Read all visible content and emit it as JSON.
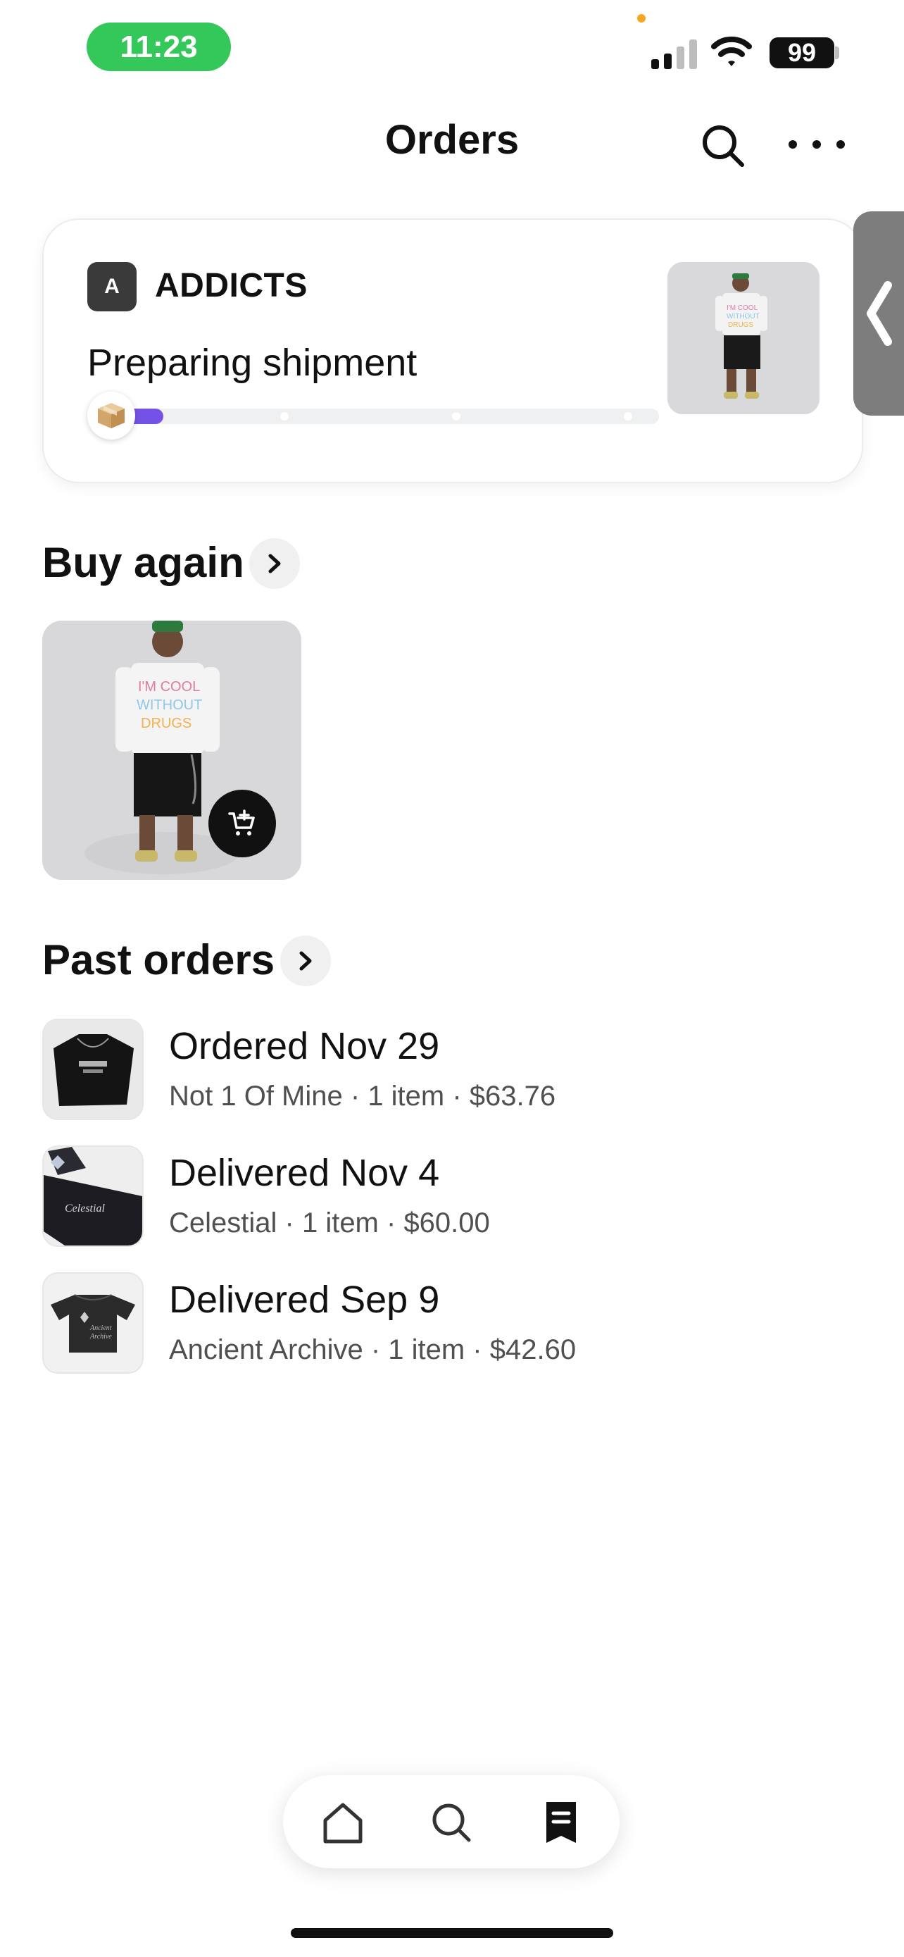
{
  "status_bar": {
    "time": "11:23",
    "battery": "99"
  },
  "header": {
    "title": "Orders",
    "search_icon": "search-icon",
    "more_icon": "more-horizontal-icon"
  },
  "current_order": {
    "store_initial": "A",
    "store_name": "ADDICTS",
    "status": "Preparing shipment",
    "progress": 0.05,
    "progress_color": "#7452e6"
  },
  "buy_again": {
    "title": "Buy again"
  },
  "past_orders": {
    "title": "Past orders",
    "items": [
      {
        "title": "Ordered Nov 29",
        "store": "Not 1 Of Mine",
        "count": "1 item",
        "price": "$63.76"
      },
      {
        "title": "Delivered Nov 4",
        "store": "Celestial",
        "count": "1 item",
        "price": "$60.00"
      },
      {
        "title": "Delivered Sep 9",
        "store": "Ancient Archive",
        "count": "1 item",
        "price": "$42.60"
      }
    ]
  },
  "bottom_nav": {
    "items": [
      "home-icon",
      "search-icon",
      "receipt-icon"
    ],
    "active": "receipt-icon"
  },
  "colors": {
    "status_pill": "#34c759",
    "accent": "#7452e6"
  }
}
